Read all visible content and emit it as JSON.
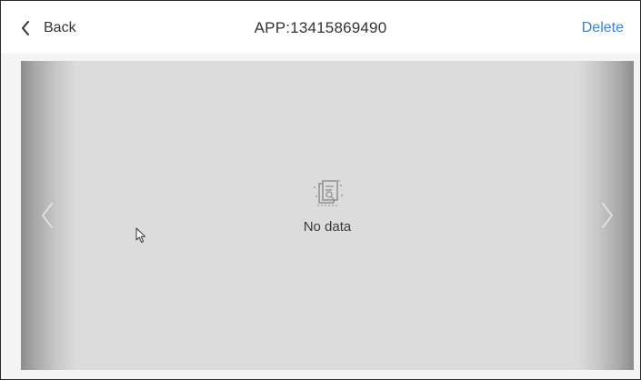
{
  "header": {
    "back_label": "Back",
    "title": "APP:13415869490",
    "delete_label": "Delete"
  },
  "viewer": {
    "empty_text": "No data"
  },
  "icons": {
    "back": "chevron-left-icon",
    "prev": "chevron-left-icon",
    "next": "chevron-right-icon",
    "empty": "empty-document-icon",
    "cursor": "mouse-pointer-icon"
  },
  "colors": {
    "accent": "#3d7fd9",
    "text": "#333333",
    "viewer_bg": "#dcdcdc",
    "page_bg": "#f4f4f4"
  }
}
